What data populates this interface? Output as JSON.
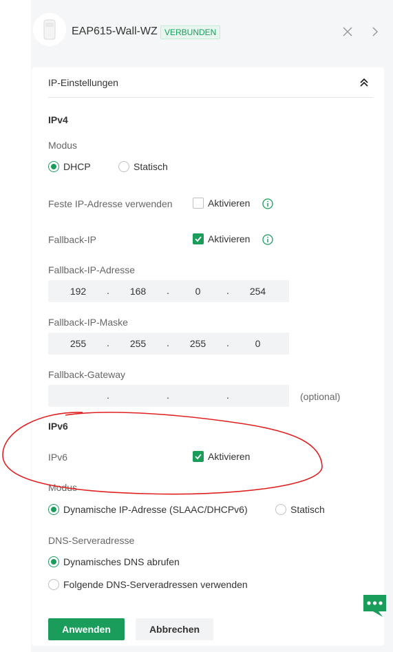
{
  "header": {
    "device_name": "EAP615-Wall-WZ",
    "status_badge": "VERBUNDEN"
  },
  "section": {
    "title": "IP-Einstellungen"
  },
  "ipv4": {
    "heading": "IPv4",
    "mode_label": "Modus",
    "mode_options": [
      {
        "label": "DHCP",
        "selected": true
      },
      {
        "label": "Statisch",
        "selected": false
      }
    ],
    "fixed_ip_label": "Feste IP-Adresse verwenden",
    "fixed_ip_checkbox": {
      "label": "Aktivieren",
      "checked": false
    },
    "fallback_ip_label": "Fallback-IP",
    "fallback_ip_checkbox": {
      "label": "Aktivieren",
      "checked": true
    },
    "fallback_address_label": "Fallback-IP-Adresse",
    "fallback_address": [
      "192",
      "168",
      "0",
      "254"
    ],
    "fallback_mask_label": "Fallback-IP-Maske",
    "fallback_mask": [
      "255",
      "255",
      "255",
      "0"
    ],
    "fallback_gateway_label": "Fallback-Gateway",
    "fallback_gateway": [
      "",
      "",
      "",
      ""
    ],
    "fallback_gateway_hint": "(optional)",
    "separator": "."
  },
  "ipv6": {
    "heading": "IPv6",
    "enable_label": "IPv6",
    "enable_checkbox": {
      "label": "Aktivieren",
      "checked": true
    },
    "mode_label": "Modus",
    "mode_options": [
      {
        "label": "Dynamische IP-Adresse (SLAAC/DHCPv6)",
        "selected": true
      },
      {
        "label": "Statisch",
        "selected": false
      }
    ],
    "dns_label": "DNS-Serveradresse",
    "dns_options": [
      {
        "label": "Dynamisches DNS abrufen",
        "selected": true
      },
      {
        "label": "Folgende DNS-Serveradressen verwenden",
        "selected": false
      }
    ]
  },
  "actions": {
    "apply": "Anwenden",
    "cancel": "Abbrechen"
  },
  "colors": {
    "accent": "#1a9c5b",
    "annotation": "#e02020"
  },
  "icons": [
    "access-point-icon",
    "close-icon",
    "chevron-right-icon",
    "double-chevron-up-icon",
    "info-icon",
    "chat-icon"
  ]
}
